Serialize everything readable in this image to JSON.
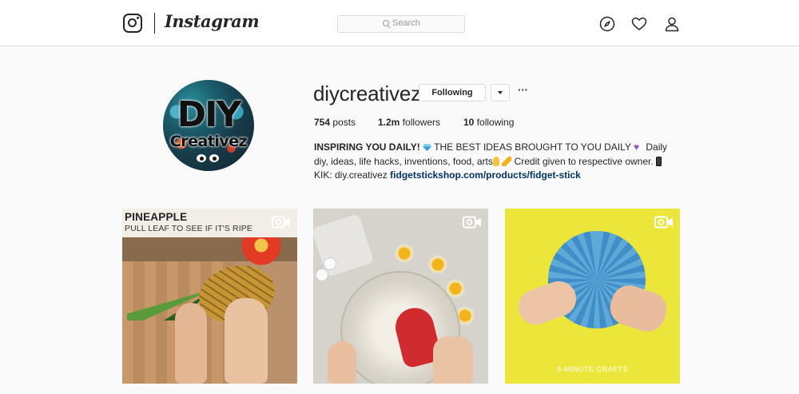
{
  "header": {
    "brand": "Instagram",
    "search_placeholder": "Search",
    "icons": [
      "instagram-glyph-icon",
      "compass-icon",
      "heart-icon",
      "user-icon"
    ]
  },
  "profile": {
    "username": "diycreativez",
    "follow_label": "Following",
    "avatar_text_main": "DIY",
    "avatar_text_sub": "Creativez",
    "stats": {
      "posts_count": "754",
      "posts_label": "posts",
      "followers_count": "1.2m",
      "followers_label": "followers",
      "following_count": "10",
      "following_label": "following"
    },
    "bio": {
      "name": "INSPIRING YOU DAILY!",
      "text1": "THE BEST IDEAS BROUGHT TO YOU DAILY",
      "text2": "Daily diy, ideas, life hacks, inventions, food, arts",
      "text3": "Credit given to respective owner.",
      "text4": "KIK: diy.creativez",
      "link": "fidgetstickshop.com/products/fidget-stick"
    }
  },
  "posts": [
    {
      "type": "video",
      "title": "PINEAPPLE",
      "subtitle": "PULL LEAF TO SEE IF IT'S RIPE"
    },
    {
      "type": "video"
    },
    {
      "type": "video",
      "watermark": "5-MINUTE CRAFTS"
    }
  ],
  "colors": {
    "background": "#fafafa",
    "border": "#dbdbdb",
    "text": "#262626",
    "link": "#003569"
  }
}
